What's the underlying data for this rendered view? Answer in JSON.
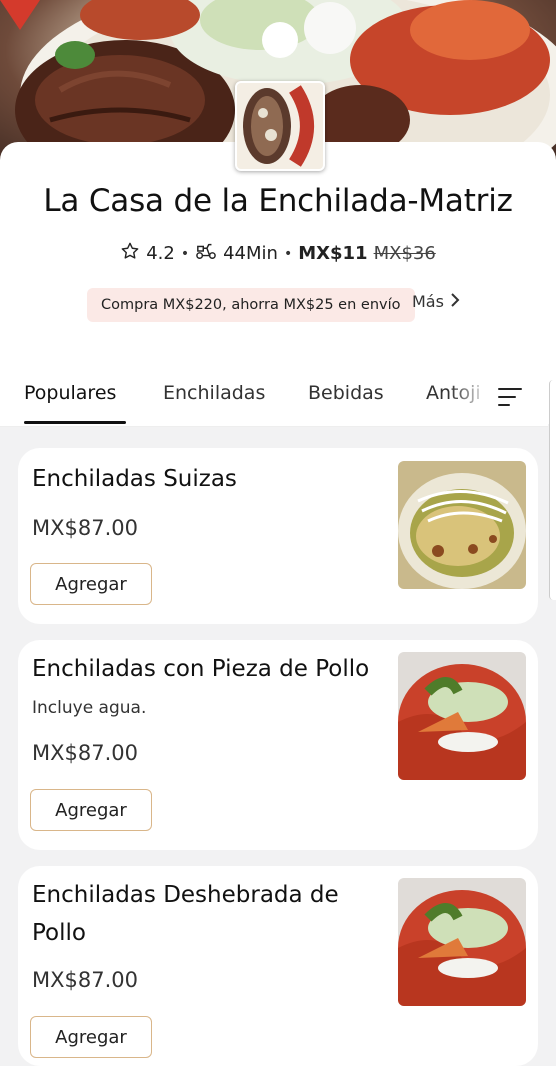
{
  "restaurant": {
    "name": "La Casa de la Enchilada-Matriz",
    "rating": "4.2",
    "delivery_time": "44Min",
    "delivery_fee": "MX$11",
    "delivery_fee_original": "MX$36",
    "promo_text": "Compra MX$220, ahorra MX$25 en envío",
    "more_label": "Más"
  },
  "tabs": [
    {
      "label": "Populares",
      "active": true
    },
    {
      "label": "Enchiladas",
      "active": false
    },
    {
      "label": "Bebidas",
      "active": false
    },
    {
      "label": "Antoji",
      "active": false
    }
  ],
  "items": [
    {
      "name": "Enchiladas Suizas",
      "description": "",
      "price": "MX$87.00",
      "button_label": "Agregar"
    },
    {
      "name": "Enchiladas con Pieza de Pollo",
      "description": "Incluye agua.",
      "price": "MX$87.00",
      "button_label": "Agregar"
    },
    {
      "name": "Enchiladas Deshebrada de Pollo",
      "description": "",
      "price": "MX$87.00",
      "button_label": "Agregar"
    }
  ],
  "icons": {
    "rating": "star-outline-icon",
    "delivery": "scooter-icon",
    "more": "chevron-right-icon",
    "menu": "menu-list-icon"
  },
  "colors": {
    "promo_bg": "#fbe9e6",
    "button_border": "#d9b68a",
    "background": "#f2f2f3"
  }
}
